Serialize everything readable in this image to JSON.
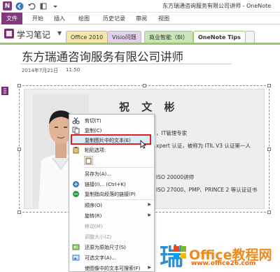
{
  "window": {
    "title": "东方瑞通咨询服务有限公司讲师 - OneNote",
    "controls": "?"
  },
  "ribbon": {
    "tabs": [
      "文件",
      "开始",
      "插入",
      "绘图",
      "历史记录",
      "审阅",
      "视图"
    ]
  },
  "notebook": {
    "name": "学习笔记",
    "sections": [
      {
        "label": "Office 2010",
        "color": "#f6e6a9"
      },
      {
        "label": "Visio问题",
        "color": "#e3d0ea"
      },
      {
        "label": "商业智能（BI）",
        "color": "#c9e6b4"
      },
      {
        "label": "OneNote Tips",
        "color": "#ffffff"
      }
    ]
  },
  "page": {
    "title": "东方瑞通咨询服务有限公司讲师",
    "date": "2014年7月21日",
    "time": "11:50"
  },
  "image": {
    "heading": "祝 文 彬",
    "lines": [
      "，IT管理专家",
      "xpert 认证，被称为 ITIL V3 认证第一人",
      "ISO 20000讲师",
      "ISO 27000、PMP、PRINCE 2 等认证证书"
    ]
  },
  "context_menu": {
    "items": [
      {
        "label": "剪切(T)",
        "icon": "scissors-icon",
        "disabled": false
      },
      {
        "label": "复制(C)",
        "icon": "copy-icon",
        "disabled": false
      },
      {
        "label": "复制图片中的文本(E)",
        "icon": "",
        "disabled": false
      },
      {
        "label": "粘贴选项:",
        "icon": "paste-icon",
        "disabled": false
      },
      {
        "label": "另存为(A)...",
        "icon": "",
        "disabled": false
      },
      {
        "label": "链接(I)...  (Ctrl+K)",
        "icon": "link-icon",
        "disabled": false
      },
      {
        "label": "复制指向段落的链接(P)",
        "icon": "link-copy-icon",
        "disabled": false
      },
      {
        "label": "顺序(O)",
        "icon": "",
        "disabled": false,
        "submenu": true
      },
      {
        "label": "旋转(R)",
        "icon": "",
        "disabled": false,
        "submenu": true
      },
      {
        "label": "移动(M)",
        "icon": "",
        "disabled": true
      },
      {
        "label": "调整大小(Z)",
        "icon": "",
        "disabled": true
      },
      {
        "label": "还原为原始尺寸(S)",
        "icon": "restore-size-icon",
        "disabled": false
      },
      {
        "label": "可选文字(A)...",
        "icon": "alt-text-icon",
        "disabled": false
      },
      {
        "label": "使图像中的文本可搜索(F)",
        "icon": "",
        "disabled": false,
        "submenu": true
      }
    ]
  },
  "watermark": {
    "char": "瑞",
    "brand": "Office教程网",
    "site": "www.office26.com"
  },
  "colors": {
    "accent": "#80397b",
    "highlight_box": "#e02020"
  }
}
